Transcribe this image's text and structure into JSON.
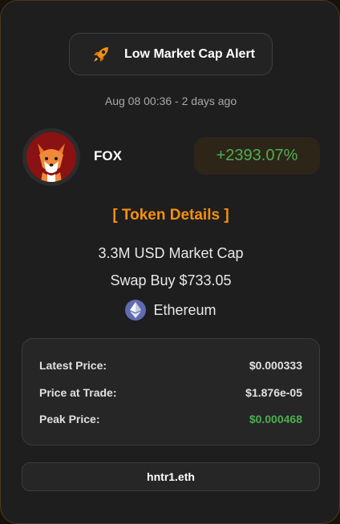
{
  "alert": {
    "title": "Low Market Cap Alert",
    "icon": "rocket-icon"
  },
  "timestamp": "Aug 08 00:36 - 2 days ago",
  "token": {
    "symbol": "FOX",
    "avatar_icon": "fox-avatar-icon",
    "change": "+2393.07%",
    "change_color": "#4caf50"
  },
  "details_link": "[ Token Details ]",
  "market_cap": "3.3M USD Market Cap",
  "swap_buy": "Swap Buy $733.05",
  "chain": {
    "name": "Ethereum",
    "icon": "ethereum-icon"
  },
  "prices": [
    {
      "label": "Latest Price:",
      "value": "$0.000333"
    },
    {
      "label": "Price at Trade:",
      "value": "$1.876e-05"
    },
    {
      "label": "Peak Price:",
      "value": "$0.000468"
    }
  ],
  "wallet": "hntr1.eth",
  "colors": {
    "accent": "#f5900f",
    "positive": "#4caf50",
    "card_bg": "#1e1e1e"
  }
}
